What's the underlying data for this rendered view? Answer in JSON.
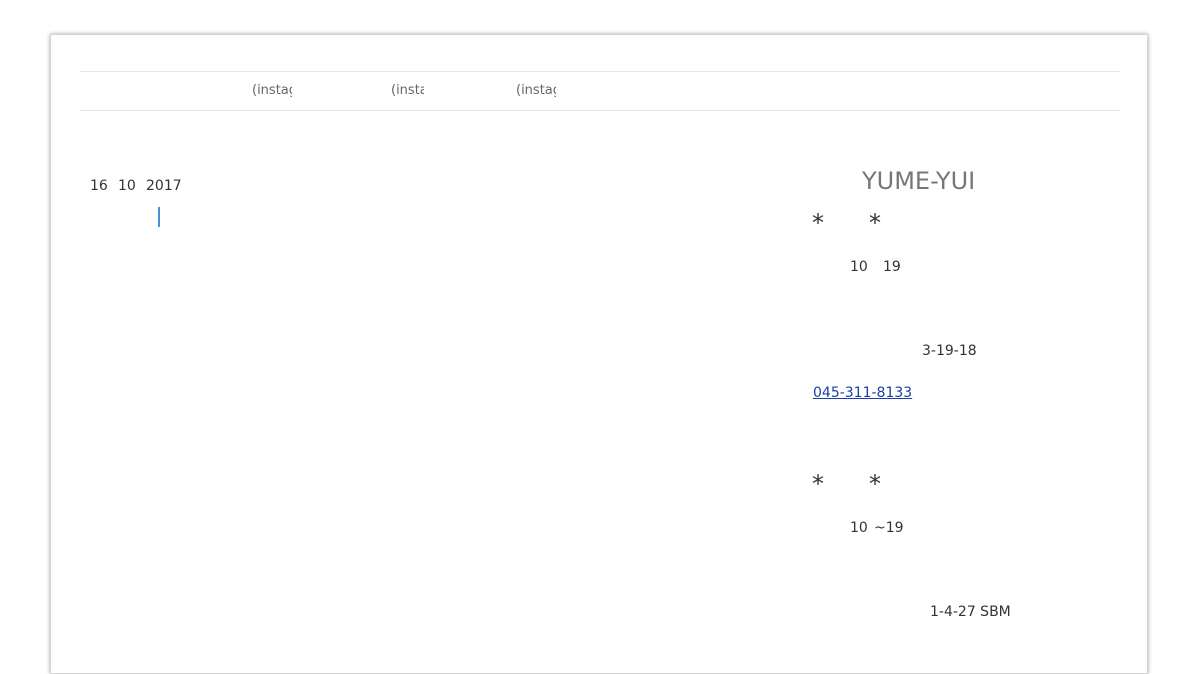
{
  "nav": {
    "items": [
      {
        "label": "(instagram)"
      },
      {
        "label": "(instagram)"
      },
      {
        "label": "(instagram)"
      }
    ]
  },
  "post": {
    "date_day": "16",
    "date_month": "10",
    "date_year": "2017"
  },
  "sidebar": {
    "shop_title": "YUME-YUI",
    "star": "*",
    "section1": {
      "hours_start": "10",
      "hours_end": "19",
      "address": "3-19-18",
      "phone": "045-311-8133"
    },
    "section2": {
      "hours_start": "10",
      "hours_end": "~19",
      "address": "1-4-27 SBM"
    }
  },
  "colors": {
    "link": "#1a3fa6",
    "accent_cursor": "#4a90d9"
  }
}
